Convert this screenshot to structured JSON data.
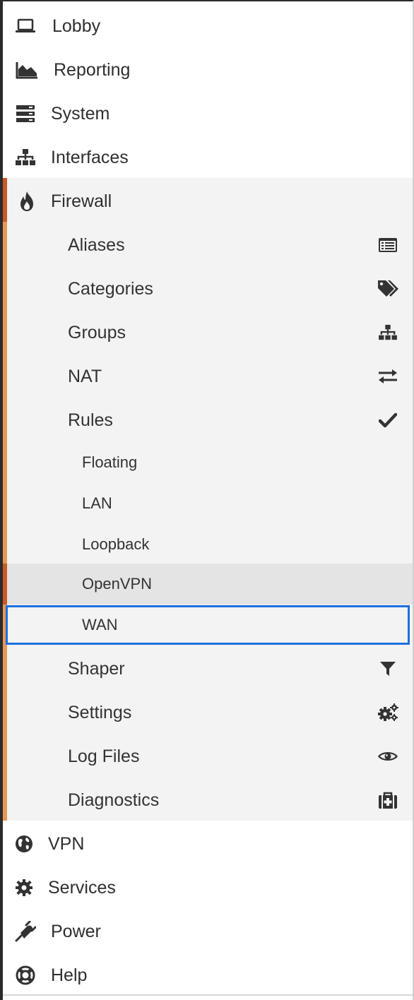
{
  "menu": {
    "top_items": [
      {
        "label": "Lobby",
        "icon": "laptop-icon"
      },
      {
        "label": "Reporting",
        "icon": "area-chart-icon"
      },
      {
        "label": "System",
        "icon": "server-icon"
      },
      {
        "label": "Interfaces",
        "icon": "sitemap-icon"
      },
      {
        "label": "Firewall",
        "icon": "fire-icon"
      }
    ],
    "firewall": {
      "items": [
        {
          "label": "Aliases",
          "icon": "list-alt-icon"
        },
        {
          "label": "Categories",
          "icon": "tags-icon"
        },
        {
          "label": "Groups",
          "icon": "sitemap-icon"
        },
        {
          "label": "NAT",
          "icon": "exchange-icon"
        },
        {
          "label": "Rules",
          "icon": "check-icon"
        }
      ],
      "rules": [
        {
          "label": "Floating"
        },
        {
          "label": "LAN"
        },
        {
          "label": "Loopback"
        },
        {
          "label": "OpenVPN"
        },
        {
          "label": "WAN"
        }
      ],
      "more_items": [
        {
          "label": "Shaper",
          "icon": "filter-icon"
        },
        {
          "label": "Settings",
          "icon": "cogs-icon"
        },
        {
          "label": "Log Files",
          "icon": "eye-icon"
        },
        {
          "label": "Diagnostics",
          "icon": "medkit-icon"
        }
      ]
    },
    "bottom_items": [
      {
        "label": "VPN",
        "icon": "globe-icon"
      },
      {
        "label": "Services",
        "icon": "cog-icon"
      },
      {
        "label": "Power",
        "icon": "plug-icon"
      },
      {
        "label": "Help",
        "icon": "life-ring-icon"
      }
    ]
  },
  "colors": {
    "accent_dark": "#c75a27",
    "accent_light": "#e49a55",
    "selection_border": "#1f6fe0",
    "submenu_bg": "#f3f3f3"
  }
}
